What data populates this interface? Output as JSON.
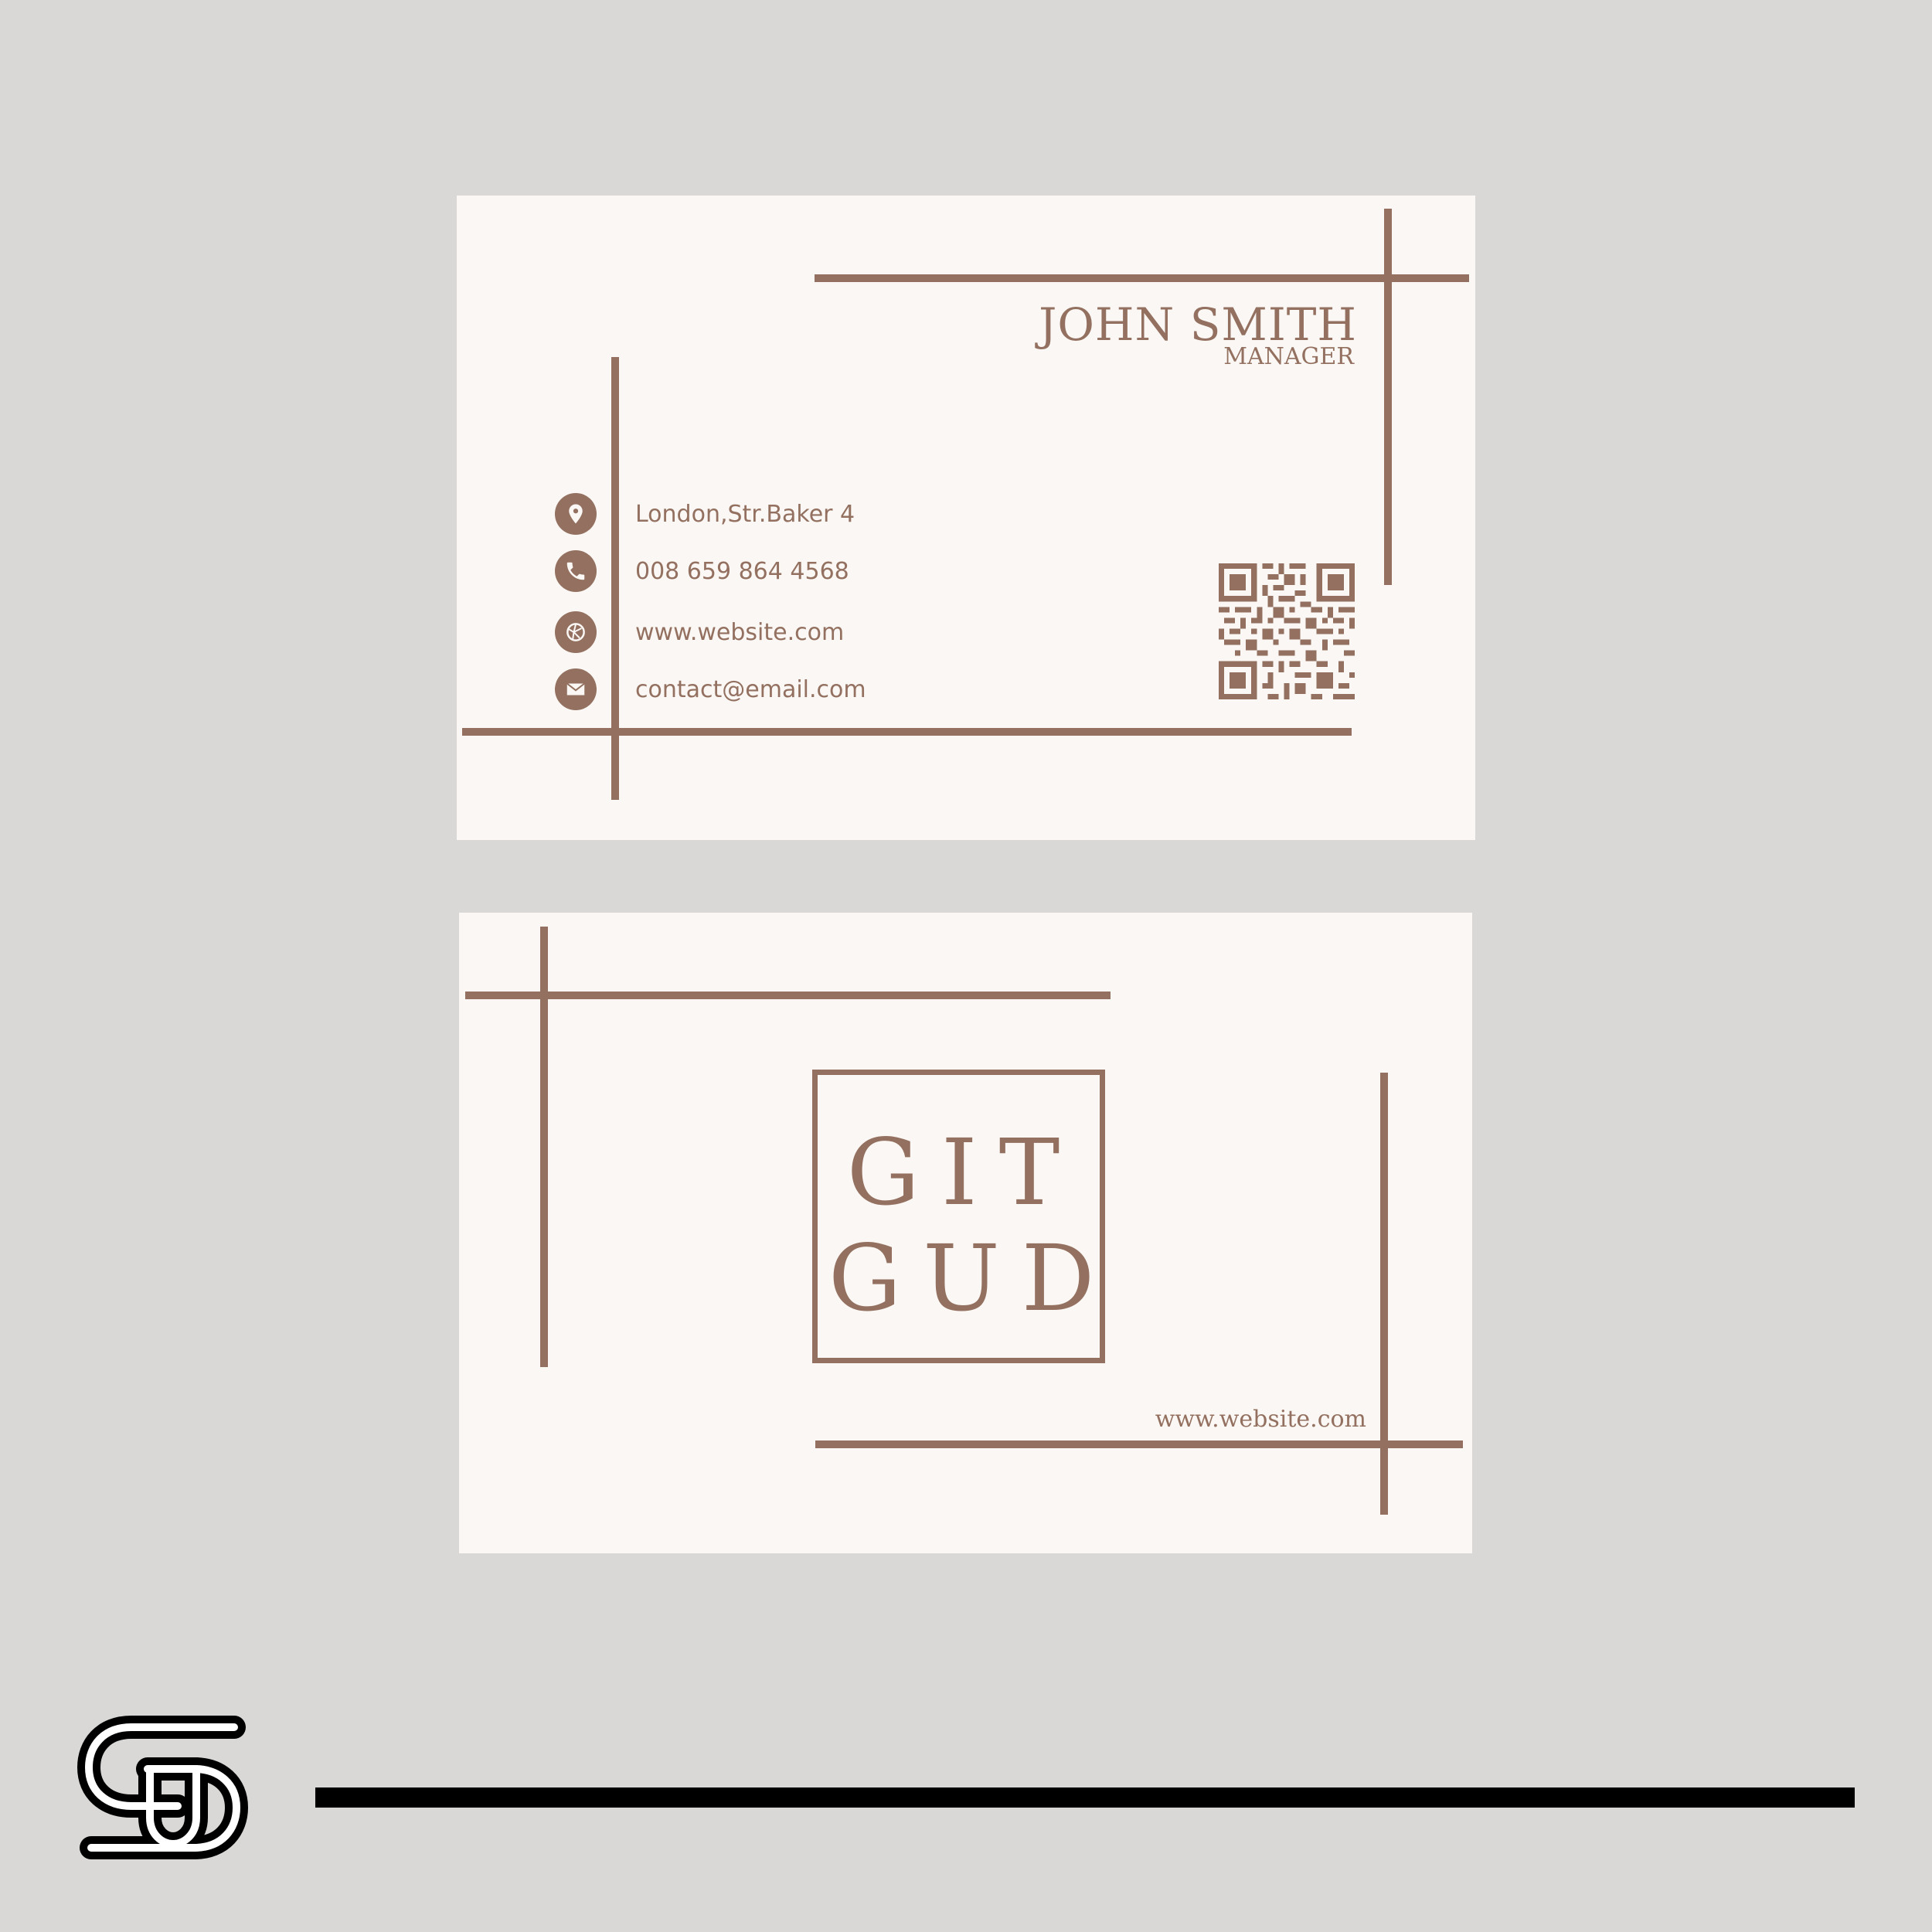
{
  "front": {
    "name": "JOHN SMITH",
    "role": "MANAGER",
    "contacts": [
      {
        "icon": "location-pin-icon",
        "text": "London,Str.Baker 4"
      },
      {
        "icon": "phone-icon",
        "text": "008 659 864 4568"
      },
      {
        "icon": "globe-icon",
        "text": "www.website.com"
      },
      {
        "icon": "envelope-icon",
        "text": "contact@email.com"
      }
    ],
    "qr_icon": "qr-code-icon"
  },
  "back": {
    "logo_line1": "GIT",
    "logo_line2": "GUD",
    "website": "www.website.com"
  },
  "colors": {
    "background": "#d9d8d6",
    "card": "#faf7f4",
    "accent": "#93705f",
    "bottom_bar": "#000000"
  },
  "brand_icon": "intertwined-s-logo-icon"
}
